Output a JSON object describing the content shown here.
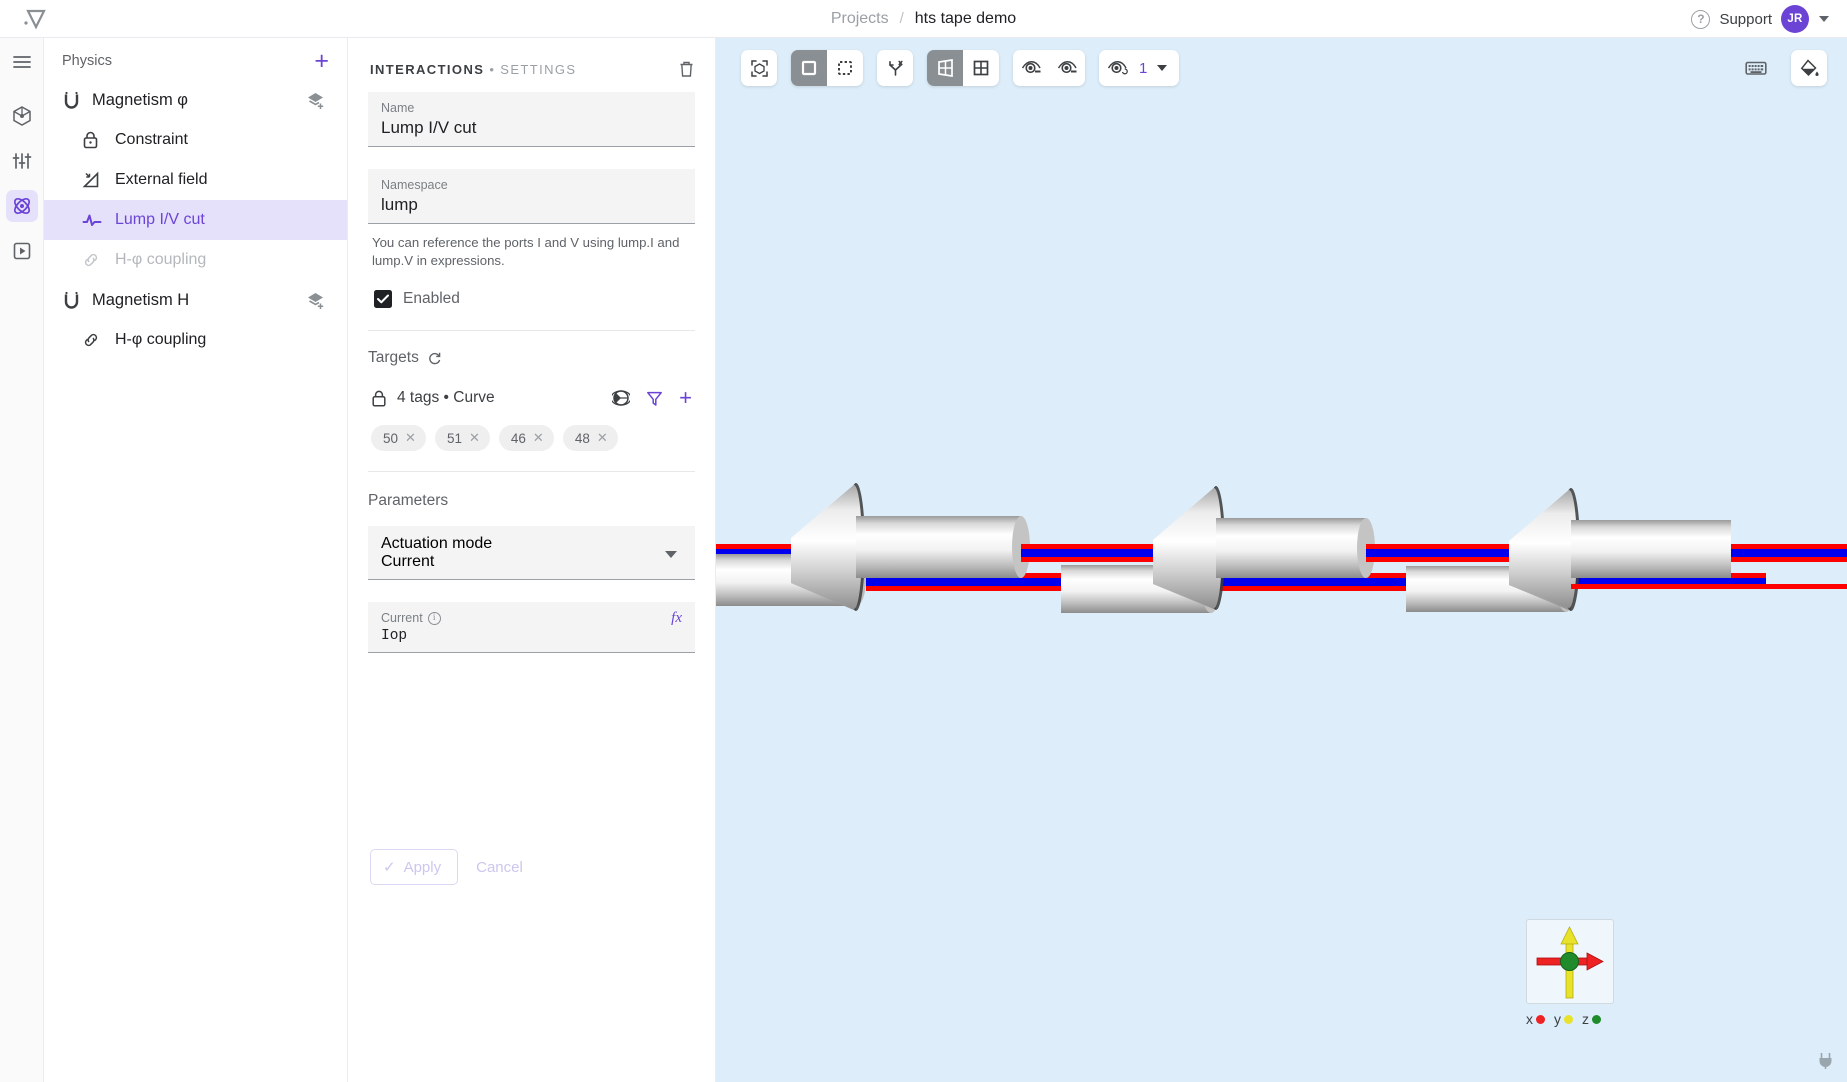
{
  "topbar": {
    "breadcrumb_root": "Projects",
    "breadcrumb_sep": "/",
    "breadcrumb_current": "hts tape demo",
    "support_label": "Support",
    "help_glyph": "?",
    "avatar_initials": "JR"
  },
  "rail": {
    "items": [
      {
        "name": "menu-icon",
        "label": "Menu"
      },
      {
        "name": "geometry-icon",
        "label": "Geometry"
      },
      {
        "name": "materials-icon",
        "label": "Materials"
      },
      {
        "name": "physics-icon",
        "label": "Physics"
      },
      {
        "name": "run-icon",
        "label": "Run"
      }
    ]
  },
  "tree": {
    "title": "Physics",
    "add_glyph": "+",
    "groups": [
      {
        "label": "Magnetism φ",
        "children": [
          {
            "label": "Constraint",
            "icon": "lock-icon",
            "state": "normal"
          },
          {
            "label": "External field",
            "icon": "external-field-icon",
            "state": "normal"
          },
          {
            "label": "Lump I/V cut",
            "icon": "waveform-icon",
            "state": "selected"
          },
          {
            "label": "H-φ coupling",
            "icon": "link-icon",
            "state": "disabled"
          }
        ]
      },
      {
        "label": "Magnetism H",
        "children": [
          {
            "label": "H-φ coupling",
            "icon": "link-icon",
            "state": "normal"
          }
        ]
      }
    ]
  },
  "settings": {
    "title_primary": "INTERACTIONS",
    "title_dot": "•",
    "title_secondary": "SETTINGS",
    "name_field": {
      "label": "Name",
      "value": "Lump I/V cut"
    },
    "namespace_field": {
      "label": "Namespace",
      "value": "lump"
    },
    "helper_text": "You can reference the ports I and V using lump.I and lump.V in expressions.",
    "enabled": {
      "label": "Enabled",
      "checked": true,
      "check_glyph": "✔"
    },
    "targets": {
      "section_title": "Targets",
      "summary": "4 tags • Curve",
      "tags": [
        "50",
        "51",
        "46",
        "48"
      ],
      "tag_remove_glyph": "✕"
    },
    "parameters": {
      "section_title": "Parameters",
      "actuation_mode": {
        "label": "Actuation mode",
        "value": "Current"
      },
      "current": {
        "label": "Current",
        "value": "Iop",
        "fx_glyph": "fx",
        "info_glyph": "i"
      }
    },
    "apply_label": "Apply",
    "apply_check": "✓",
    "cancel_label": "Cancel"
  },
  "viewport": {
    "background": "#ddeefa",
    "toolbar": [
      {
        "name": "fit-to-view-icon",
        "active": false
      },
      {
        "name": "select-solid-icon",
        "active": true
      },
      {
        "name": "select-box-icon",
        "active": false
      },
      {
        "name": "axes-icon",
        "active": false
      },
      {
        "name": "perspective-view-icon",
        "active": true
      },
      {
        "name": "grid-view-icon",
        "active": false
      },
      {
        "name": "hide-icon",
        "active": false
      },
      {
        "name": "show-icon",
        "active": false
      }
    ],
    "layer_count": "1",
    "right_tools": [
      {
        "name": "keyboard-shortcuts-icon"
      },
      {
        "name": "fill-color-icon"
      }
    ],
    "gizmo": {
      "axes": [
        {
          "label": "x",
          "color": "#ee2222"
        },
        {
          "label": "y",
          "color": "#e8e22a"
        },
        {
          "label": "z",
          "color": "#1f8b2b"
        }
      ]
    },
    "model_colors": {
      "tape_red": "#ff0000",
      "tape_blue": "#0000ee",
      "metal_light": "#ffffff",
      "metal_mid": "#c8c8c8",
      "metal_dark": "#8a8a8a"
    }
  }
}
